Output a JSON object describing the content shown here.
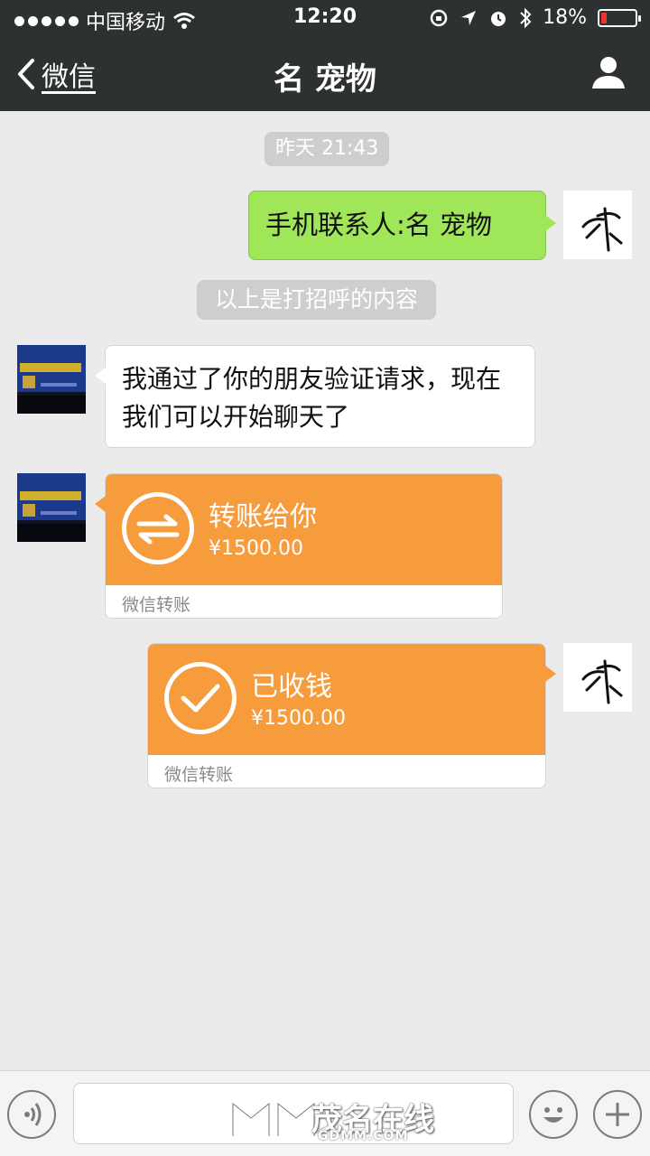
{
  "status_bar": {
    "carrier": "中国移动",
    "time": "12:20",
    "battery": "18%",
    "battery_level": 0.18
  },
  "nav": {
    "back_label": "微信",
    "title": "名 宠物"
  },
  "chat": {
    "timestamp": "昨天 21:43",
    "contact_message": "手机联系人:名 宠物",
    "system_notice": "以上是打招呼的内容",
    "friend_message": "我通过了你的朋友验证请求，现在我们可以开始聊天了",
    "transfer_sent": {
      "title": "转账给你",
      "amount": "¥1500.00",
      "footer": "微信转账"
    },
    "transfer_received": {
      "title": "已收钱",
      "amount": "¥1500.00",
      "footer": "微信转账"
    }
  },
  "watermark": {
    "text": "茂名在线",
    "sub": "GDMM.COM"
  },
  "colors": {
    "nav_bg": "#2e3132",
    "chat_bg": "#ebebeb",
    "bubble_green": "#9fe658",
    "transfer_orange": "#f79c3c"
  },
  "icons": {
    "back": "chevron-left-icon",
    "profile": "person-icon",
    "voice": "voice-icon",
    "emoji": "emoji-icon",
    "more": "plus-icon",
    "transfer": "transfer-arrows-icon",
    "received": "check-icon"
  }
}
